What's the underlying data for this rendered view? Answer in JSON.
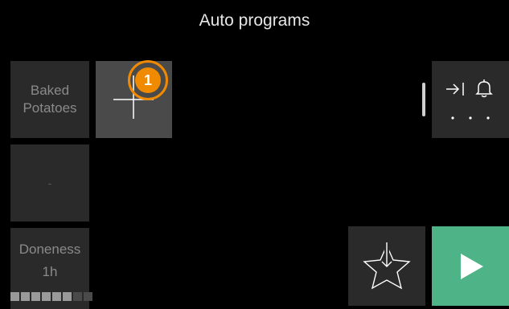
{
  "header": {
    "title": "Auto programs"
  },
  "tiles": {
    "program": {
      "line1": "Baked",
      "line2": "Potatoes"
    },
    "add": {
      "icon": "plus-icon",
      "badge": "1",
      "badge_color": "#f08a00"
    },
    "empty": {
      "label": "-"
    },
    "doneness": {
      "label": "Doneness",
      "time": "1h",
      "level_fraction": 0.67
    }
  },
  "actions": {
    "tools_icons": [
      "timer-end-icon",
      "bell-icon",
      "more-dots-icon"
    ],
    "favorite_icon": "star-download-icon",
    "start_icon": "play-icon",
    "start_color": "#4fb388"
  }
}
